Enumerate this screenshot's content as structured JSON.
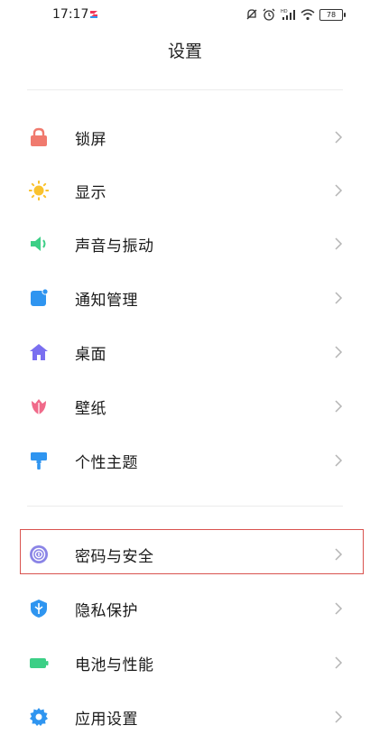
{
  "status_bar": {
    "time": "17:17",
    "battery": "78",
    "icons": [
      "notification-muted-icon",
      "alarm-icon",
      "hd-signal-icon",
      "wifi-icon",
      "battery-icon"
    ]
  },
  "header": {
    "title": "设置"
  },
  "groups": [
    {
      "items": [
        {
          "label": "锁屏",
          "icon": "lock-icon",
          "color": "#f07a6e"
        },
        {
          "label": "显示",
          "icon": "sun-icon",
          "color": "#f9c22e"
        },
        {
          "label": "声音与振动",
          "icon": "speaker-icon",
          "color": "#3ccf86"
        },
        {
          "label": "通知管理",
          "icon": "notification-icon",
          "color": "#2f95f0"
        },
        {
          "label": "桌面",
          "icon": "home-icon",
          "color": "#7a6ff0"
        },
        {
          "label": "壁纸",
          "icon": "tulip-icon",
          "color": "#f06a8a"
        },
        {
          "label": "个性主题",
          "icon": "brush-icon",
          "color": "#2f95f0"
        }
      ]
    },
    {
      "items": [
        {
          "label": "密码与安全",
          "icon": "fingerprint-icon",
          "color": "#8a84e6",
          "highlighted": true
        },
        {
          "label": "隐私保护",
          "icon": "privacy-shield-icon",
          "color": "#2f95f0"
        },
        {
          "label": "电池与性能",
          "icon": "battery-performance-icon",
          "color": "#3ccf86"
        },
        {
          "label": "应用设置",
          "icon": "gear-icon",
          "color": "#2f95f0"
        }
      ]
    }
  ],
  "highlight_color": "#d9534f"
}
